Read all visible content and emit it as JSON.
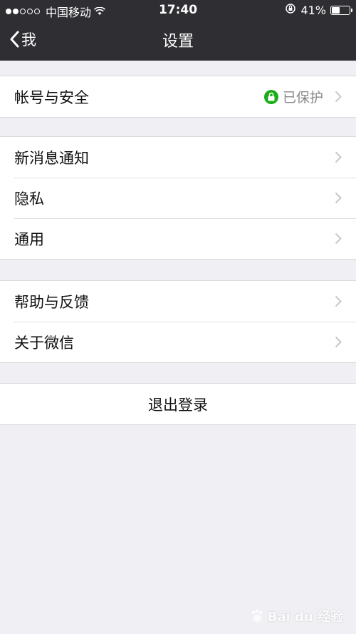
{
  "status_bar": {
    "carrier": "中国移动",
    "time": "17:40",
    "battery": "41%",
    "battery_level": 0.41
  },
  "nav": {
    "back_label": "我",
    "title": "设置"
  },
  "groups": {
    "account": {
      "label": "帐号与安全",
      "status": "已保护",
      "status_color": "#1aad19"
    },
    "general": [
      {
        "label": "新消息通知"
      },
      {
        "label": "隐私"
      },
      {
        "label": "通用"
      }
    ],
    "about": [
      {
        "label": "帮助与反馈"
      },
      {
        "label": "关于微信"
      }
    ]
  },
  "logout_label": "退出登录",
  "watermark": "Bai du 经验",
  "colors": {
    "header_bg": "#2e2e33",
    "page_bg": "#efeff4",
    "accent_green": "#1aad19"
  }
}
